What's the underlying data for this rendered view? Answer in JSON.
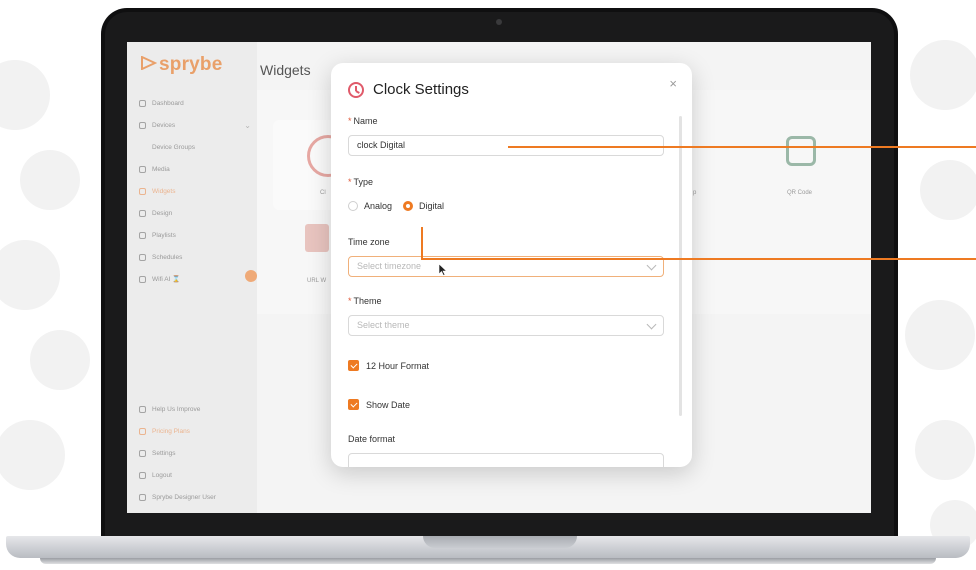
{
  "app": {
    "brand": "sprybe",
    "page_title": "Widgets"
  },
  "sidebar": {
    "items": [
      {
        "label": "Dashboard"
      },
      {
        "label": "Devices",
        "caret": "⌄"
      },
      {
        "label": "Device Groups",
        "sub": true
      },
      {
        "label": "Media"
      },
      {
        "label": "Widgets",
        "active": true
      },
      {
        "label": "Design"
      },
      {
        "label": "Playlists"
      },
      {
        "label": "Schedules"
      },
      {
        "label": "Wifi AI ⌛"
      }
    ],
    "bottom_items": [
      {
        "label": "Help Us Improve"
      },
      {
        "label": "Pricing Plans",
        "active": true
      },
      {
        "label": "Settings"
      },
      {
        "label": "Logout"
      },
      {
        "label": "Sprybe Designer User"
      }
    ]
  },
  "widgets": {
    "cards": [
      {
        "label": "Cl"
      },
      {
        "label": "p"
      },
      {
        "label": "QR Code"
      },
      {
        "label": "URL W"
      }
    ]
  },
  "dialog": {
    "title": "Clock Settings",
    "close_label": "×",
    "name": {
      "label": "Name",
      "value": "clock Digital"
    },
    "type": {
      "label": "Type",
      "options": [
        "Analog",
        "Digital"
      ],
      "selected": "Digital"
    },
    "timezone": {
      "label": "Time zone",
      "placeholder": "Select timezone"
    },
    "theme": {
      "label": "Theme",
      "placeholder": "Select theme"
    },
    "hour_format": {
      "label": "12 Hour Format",
      "checked": true
    },
    "show_date": {
      "label": "Show Date",
      "checked": true
    },
    "date_format": {
      "label": "Date format"
    }
  },
  "colors": {
    "accent": "#ee7a22",
    "brand": "#e9a06a",
    "clock_icon": "#e05a6a"
  }
}
